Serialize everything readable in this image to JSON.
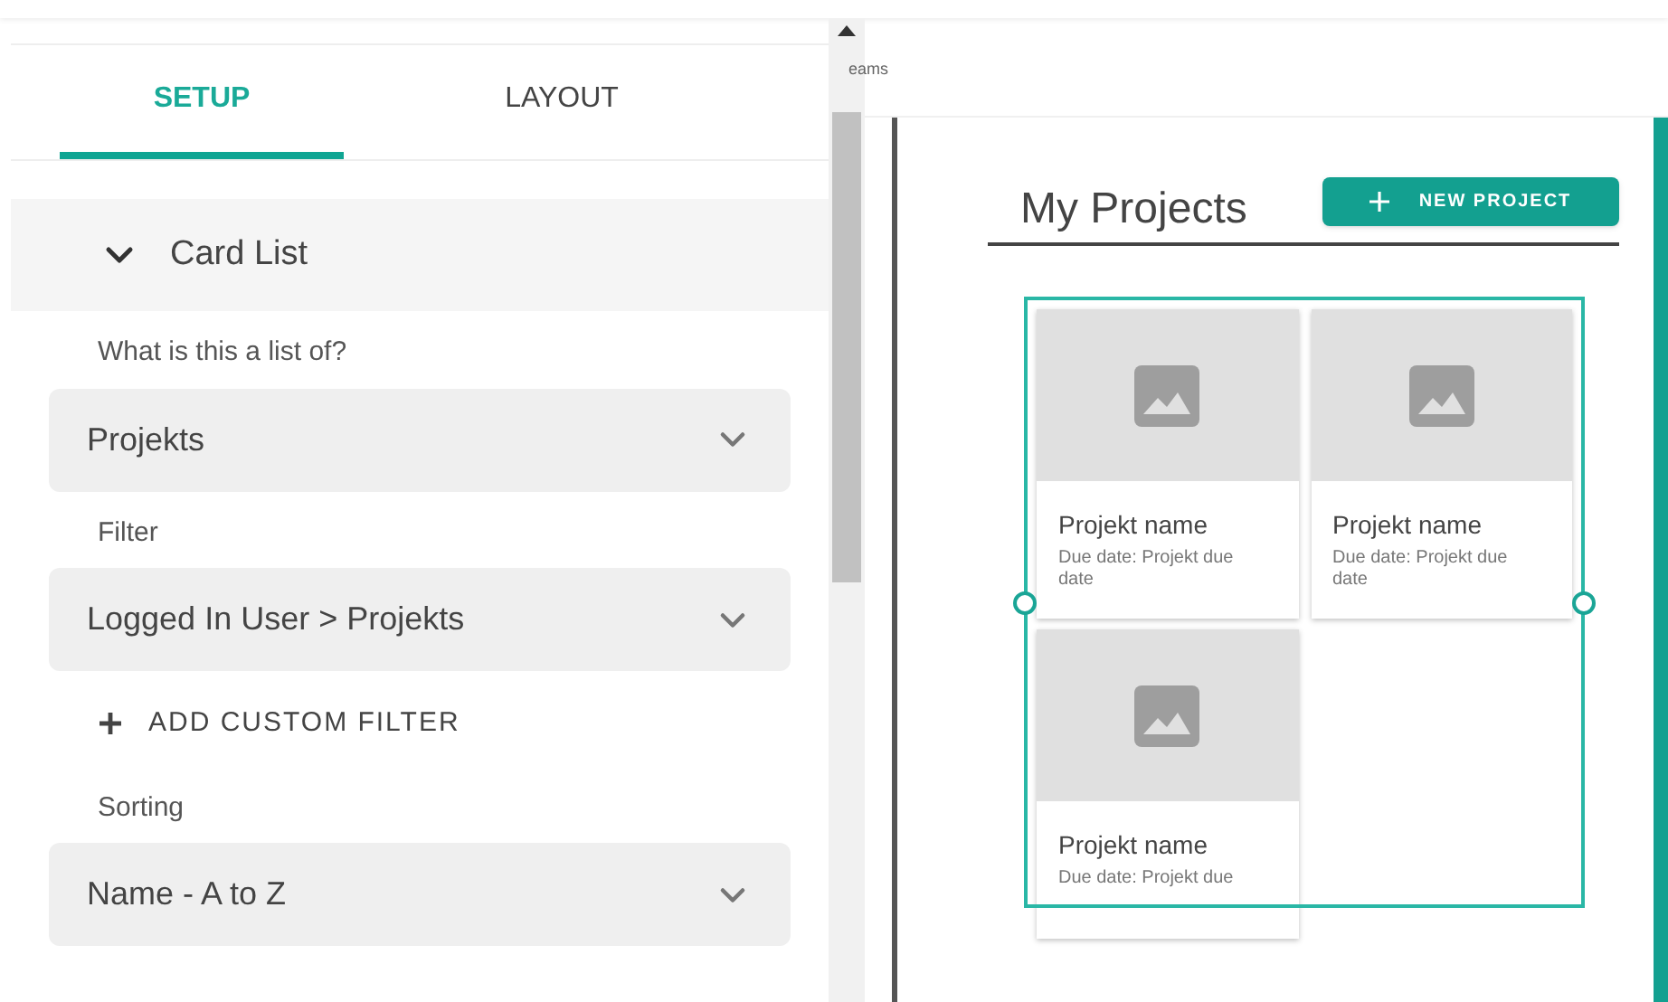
{
  "tabs": [
    {
      "label": "SETUP",
      "selected": true
    },
    {
      "label": "LAYOUT",
      "selected": false
    }
  ],
  "section": {
    "title": "Card List",
    "expanded": true
  },
  "fields": [
    {
      "label": "What is this a list of?",
      "value": "Projekts"
    },
    {
      "label": "Filter",
      "value": "Logged In User > Projekts"
    }
  ],
  "add_filter": "ADD CUSTOM FILTER",
  "sorting": {
    "label": "Sorting",
    "value": "Name - A to Z"
  },
  "canvas": {
    "breadcrumb": "eams",
    "heading": "My Projects",
    "button": "NEW PROJECT",
    "cards": [
      {
        "name": "Projekt name",
        "description": "Due date: Projekt due date"
      },
      {
        "name": "Projekt name",
        "description": "Due date: Projekt due date"
      },
      {
        "name": "Projekt name",
        "description": "Due date: Projekt due"
      }
    ]
  }
}
